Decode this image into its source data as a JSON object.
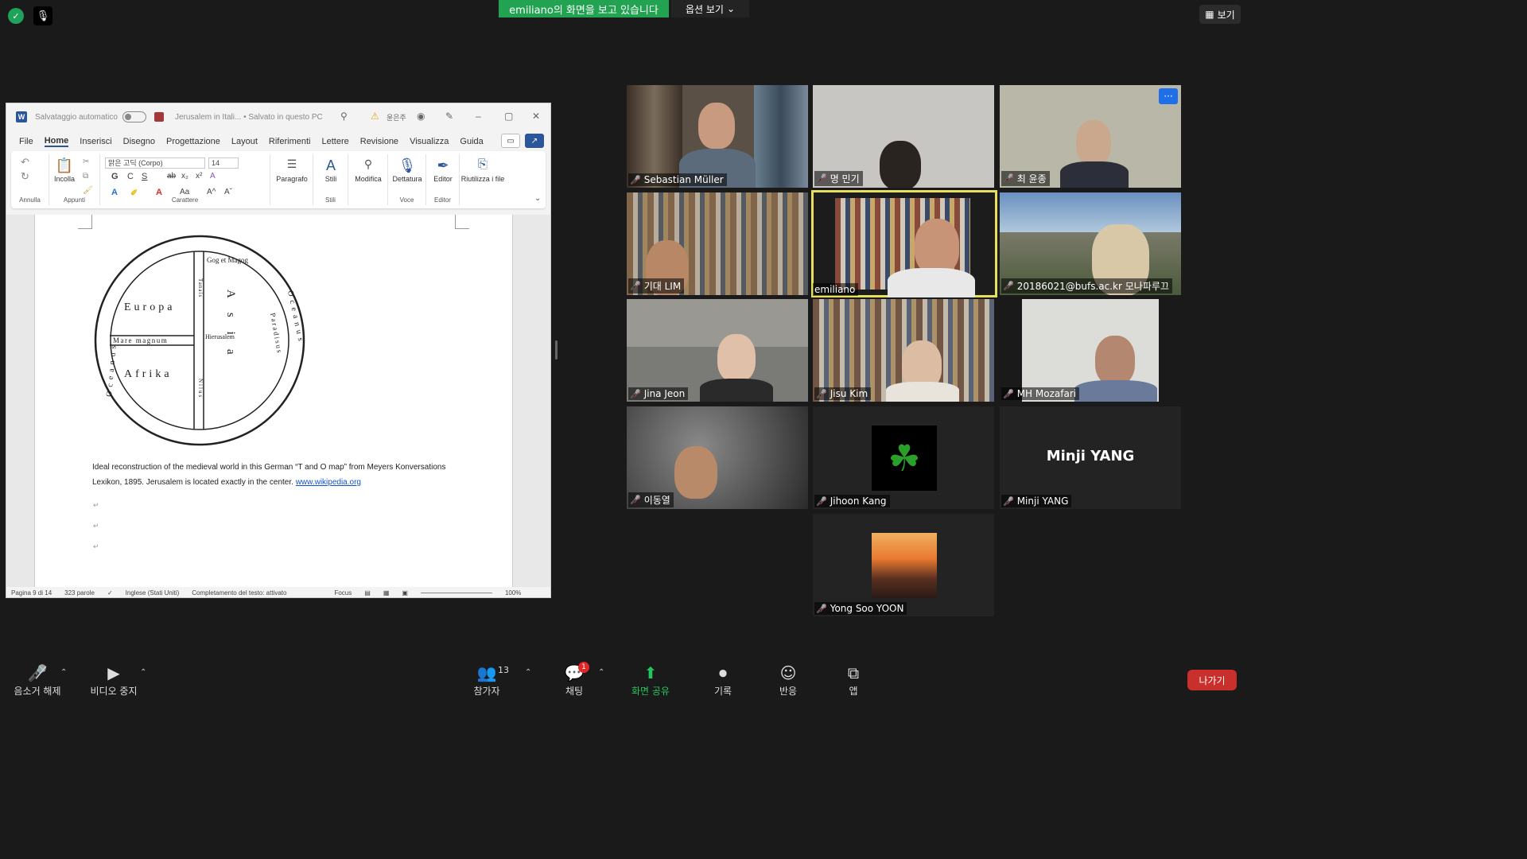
{
  "top_bar": {
    "share_banner": "emiliano의 화면을 보고 있습니다",
    "view_options": "옵션 보기",
    "view_button": "보기"
  },
  "word": {
    "autosave_label": "Salvataggio automatico",
    "doc_title": "Jerusalem in Itali... • Salvato in questo PC",
    "user_name": "윤은주",
    "tabs": [
      "File",
      "Home",
      "Inserisci",
      "Disegno",
      "Progettazione",
      "Layout",
      "Riferimenti",
      "Lettere",
      "Revisione",
      "Visualizza",
      "Guida"
    ],
    "active_tab": "Home",
    "ribbon": {
      "undo_group": "Annulla",
      "paste": "Incolla",
      "clipboard_group": "Appunti",
      "font_name": "맑은 고딕 (Corpo)",
      "font_size": "14",
      "font_group": "Carattere",
      "paragraph": "Paragrafo",
      "styles": "Stili",
      "styles_group": "Stili",
      "modify": "Modifica",
      "dictate": "Dettatura",
      "voice_group": "Voce",
      "editor": "Editor",
      "editor_group": "Editor",
      "reuse": "Riutilizza i file",
      "reuse_group": "Riutilizza i file",
      "bold": "G",
      "italic": "C",
      "underline": "S"
    },
    "map": {
      "europa": "Europa",
      "afrika": "Afrika",
      "asia": "Asia",
      "mare": "Mare magnum",
      "gog": "Gog et Magog",
      "hierusalem": "Hierusalem",
      "paradisus": "Paradisus",
      "oceanus_left": "Oceanus",
      "oceanus_right": "Oceanus",
      "tanais": "Tanais",
      "nilus": "Nilus"
    },
    "caption_text": "Ideal reconstruction of the medieval world in this German “T and O map” from Meyers Konversations Lexikon, 1895. Jerusalem is located exactly in the center. ",
    "caption_link": "www.wikipedia.org",
    "status": {
      "page": "Pagina 9 di 14",
      "words": "323 parole",
      "language": "Inglese (Stati Uniti)",
      "completion": "Completamento del testo: attivato",
      "focus": "Focus",
      "zoom": "100%"
    }
  },
  "participants": [
    {
      "name": "Sebastian Müller",
      "muted": true
    },
    {
      "name": "명 민기",
      "muted": true
    },
    {
      "name": "최 윤종",
      "muted": true
    },
    {
      "name": "기대 LIM",
      "muted": true
    },
    {
      "name": "emiliano",
      "muted": false,
      "active": true
    },
    {
      "name": "20186021@bufs.ac.kr 모나파루끄",
      "muted": true
    },
    {
      "name": "Jina Jeon",
      "muted": true
    },
    {
      "name": "Jisu Kim",
      "muted": true
    },
    {
      "name": "MH Mozafari",
      "muted": true
    },
    {
      "name": "이동열",
      "muted": true
    },
    {
      "name": "Jihoon Kang",
      "muted": true
    },
    {
      "name": "Minji YANG",
      "muted": true,
      "initials_display": "Minji YANG"
    },
    {
      "name": "Yong Soo YOON",
      "muted": true
    }
  ],
  "toolbar": {
    "unmute": "음소거 해제",
    "stop_video": "비디오 중지",
    "participants": "참가자",
    "participant_count": "13",
    "chat": "채팅",
    "chat_badge": "1",
    "share_screen": "화면 공유",
    "record": "기록",
    "reactions": "반응",
    "apps": "앱",
    "leave": "나가기"
  },
  "colors": {
    "share_green": "#22a352",
    "active_speaker": "#e8e05c",
    "leave_red": "#c9302c",
    "word_blue": "#2b579a"
  }
}
